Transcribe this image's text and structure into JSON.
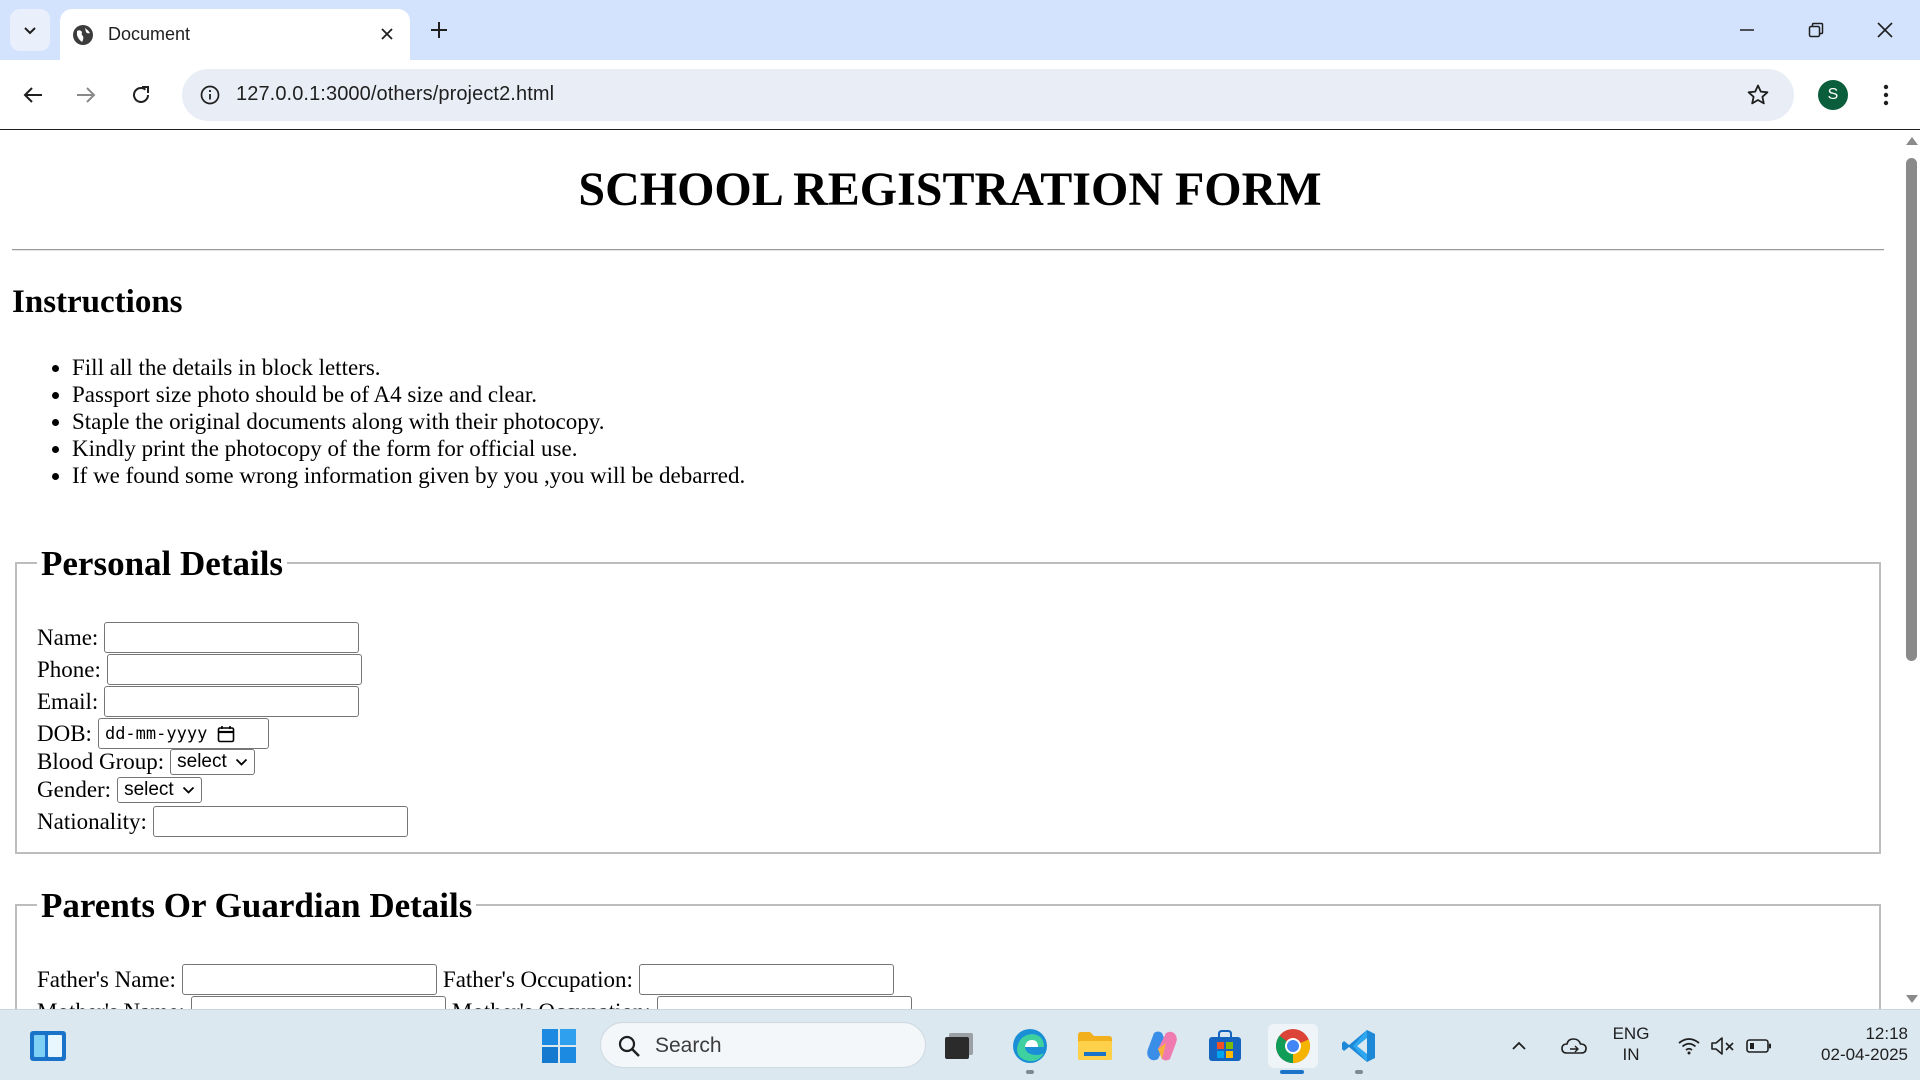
{
  "browser": {
    "tab_title": "Document",
    "url": "127.0.0.1:3000/others/project2.html",
    "profile_initial": "S"
  },
  "page": {
    "title": "SCHOOL REGISTRATION FORM",
    "instructions_heading": "Instructions",
    "instructions": [
      "Fill all the details in block letters.",
      "Passport size photo should be of A4 size and clear.",
      "Staple the original documents along with their photocopy.",
      "Kindly print the photocopy of the form for official use.",
      "If we found some wrong information given by you ,you will be debarred."
    ],
    "personal": {
      "legend": "Personal Details",
      "name_label": "Name:",
      "phone_label": "Phone:",
      "email_label": "Email:",
      "dob_label": "DOB:",
      "dob_placeholder": "dd-mm-yyyy",
      "blood_label": "Blood Group:",
      "blood_value": "select",
      "gender_label": "Gender:",
      "gender_value": "select",
      "nationality_label": "Nationality:"
    },
    "parents": {
      "legend": "Parents Or Guardian Details",
      "father_name_label": "Father's Name:",
      "father_occ_label": "Father's Occupation:",
      "mother_name_label": "Mother's Name:",
      "mother_occ_label": "Mother's Occupation:"
    }
  },
  "taskbar": {
    "search_placeholder": "Search",
    "lang_1": "ENG",
    "lang_2": "IN",
    "time": "12:18",
    "date": "02-04-2025"
  },
  "colors": {
    "tab_strip": "#d3e3fd",
    "omnibox": "#e9eef6",
    "taskbar": "#dbe8f0",
    "profile": "#0b5e3c"
  }
}
